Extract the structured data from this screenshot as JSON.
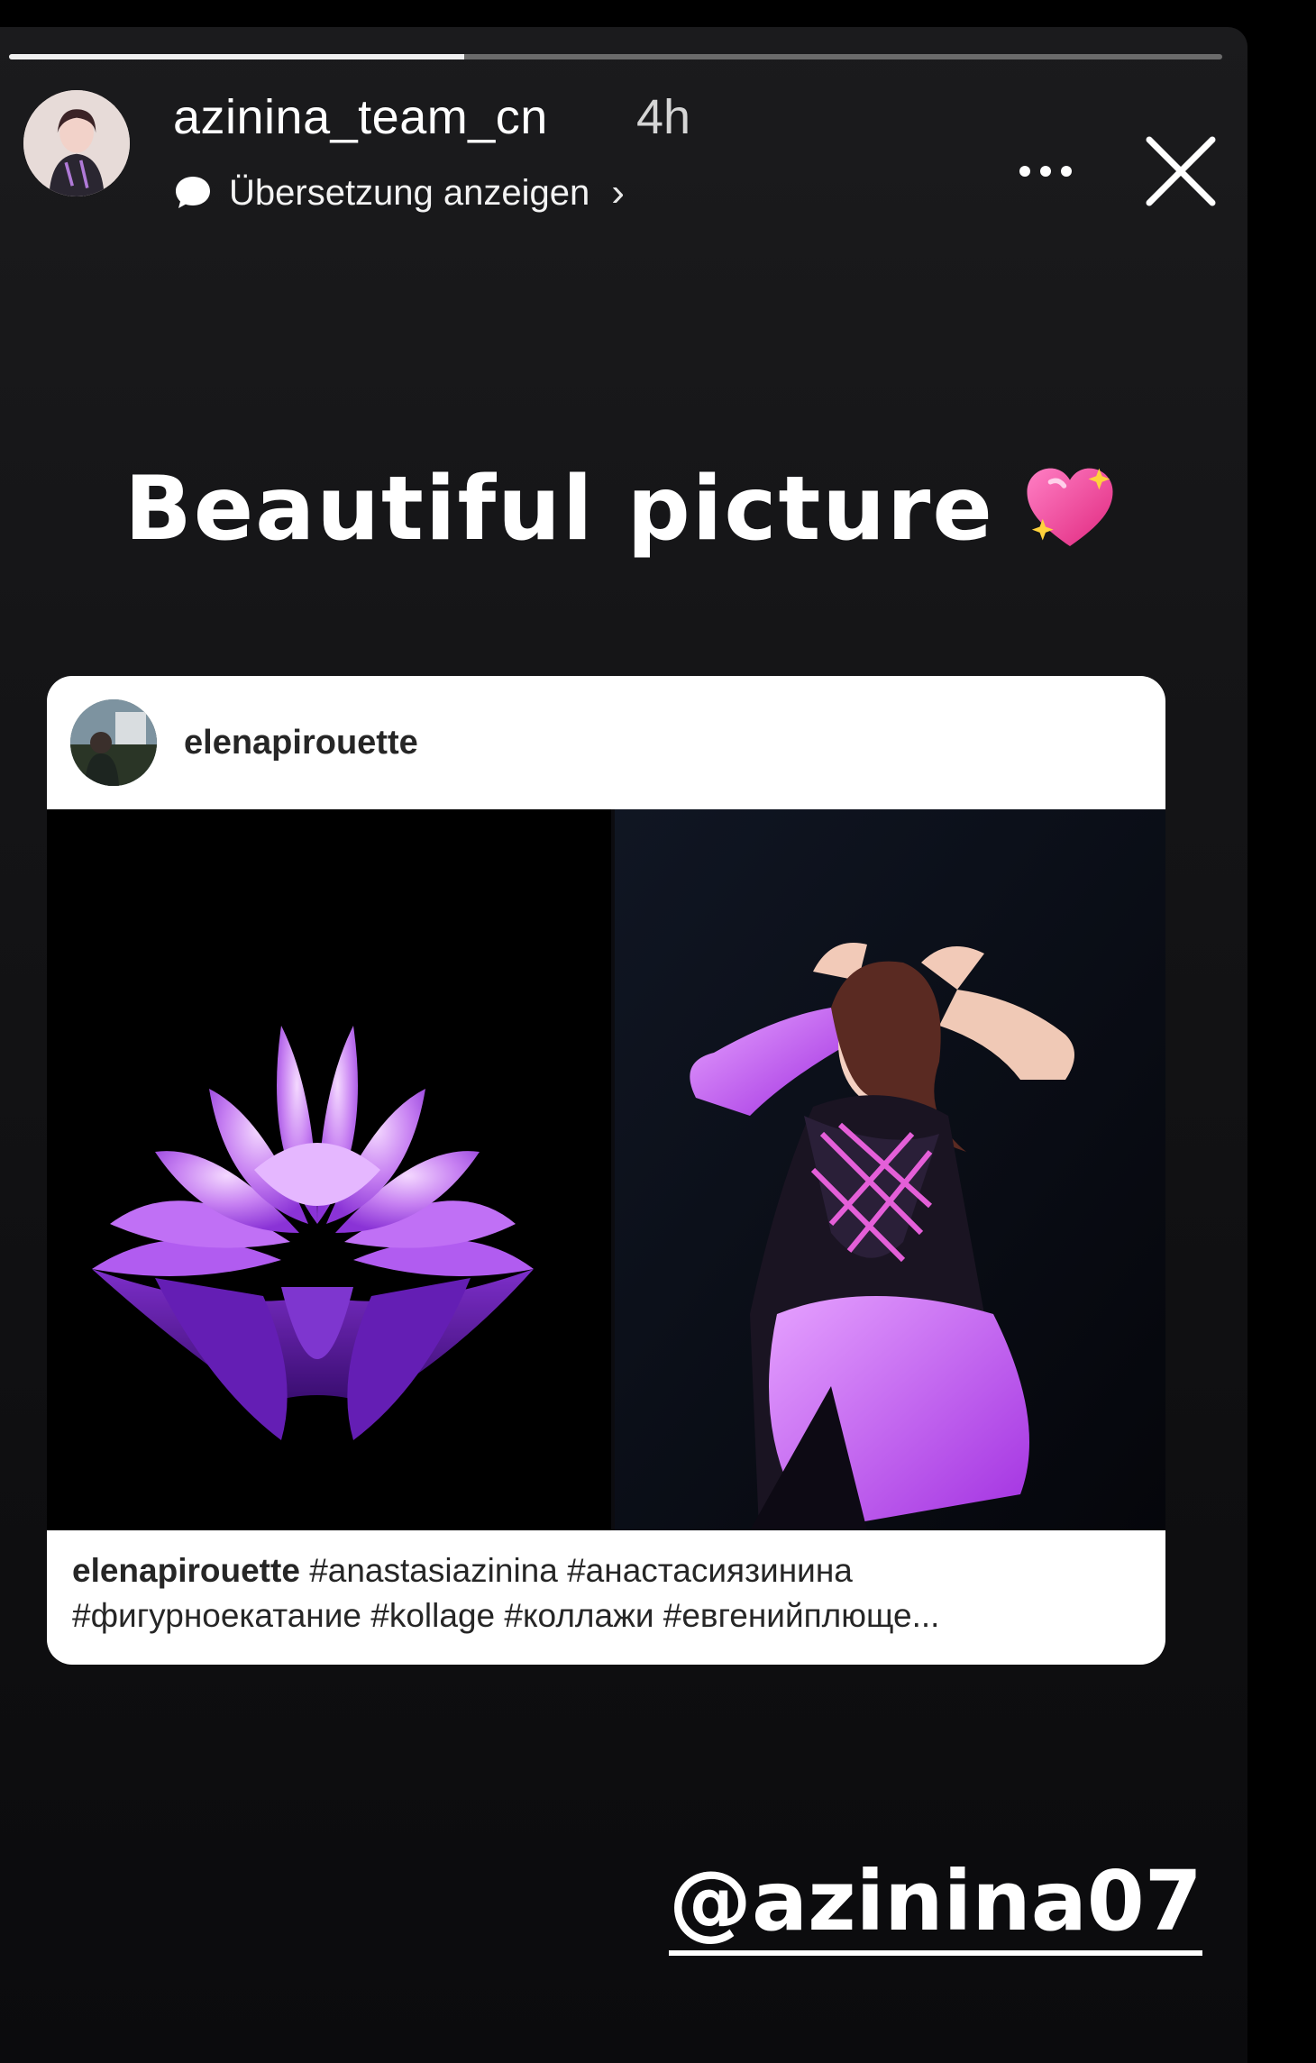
{
  "story": {
    "progress": 0.375,
    "username": "azinina_team_cn",
    "time": "4h",
    "translate_label": "Übersetzung anzeigen",
    "translate_chevron": "›",
    "more_icon": "more-horizontal-icon",
    "close_icon": "close-icon"
  },
  "caption": {
    "text": "Beautiful picture",
    "emoji": "sparkling-heart-icon"
  },
  "shared_post": {
    "username": "elenapirouette",
    "caption_user": "elenapirouette",
    "caption_line1": "#anastasiazinina #анастасиязинина",
    "caption_line2": "#фигурноекатание #kollage #коллажи #евгенийплюще..."
  },
  "mention": "@azinina07",
  "colors": {
    "background": "#121214",
    "accent_purple": "#b05be8",
    "card": "#ffffff"
  }
}
